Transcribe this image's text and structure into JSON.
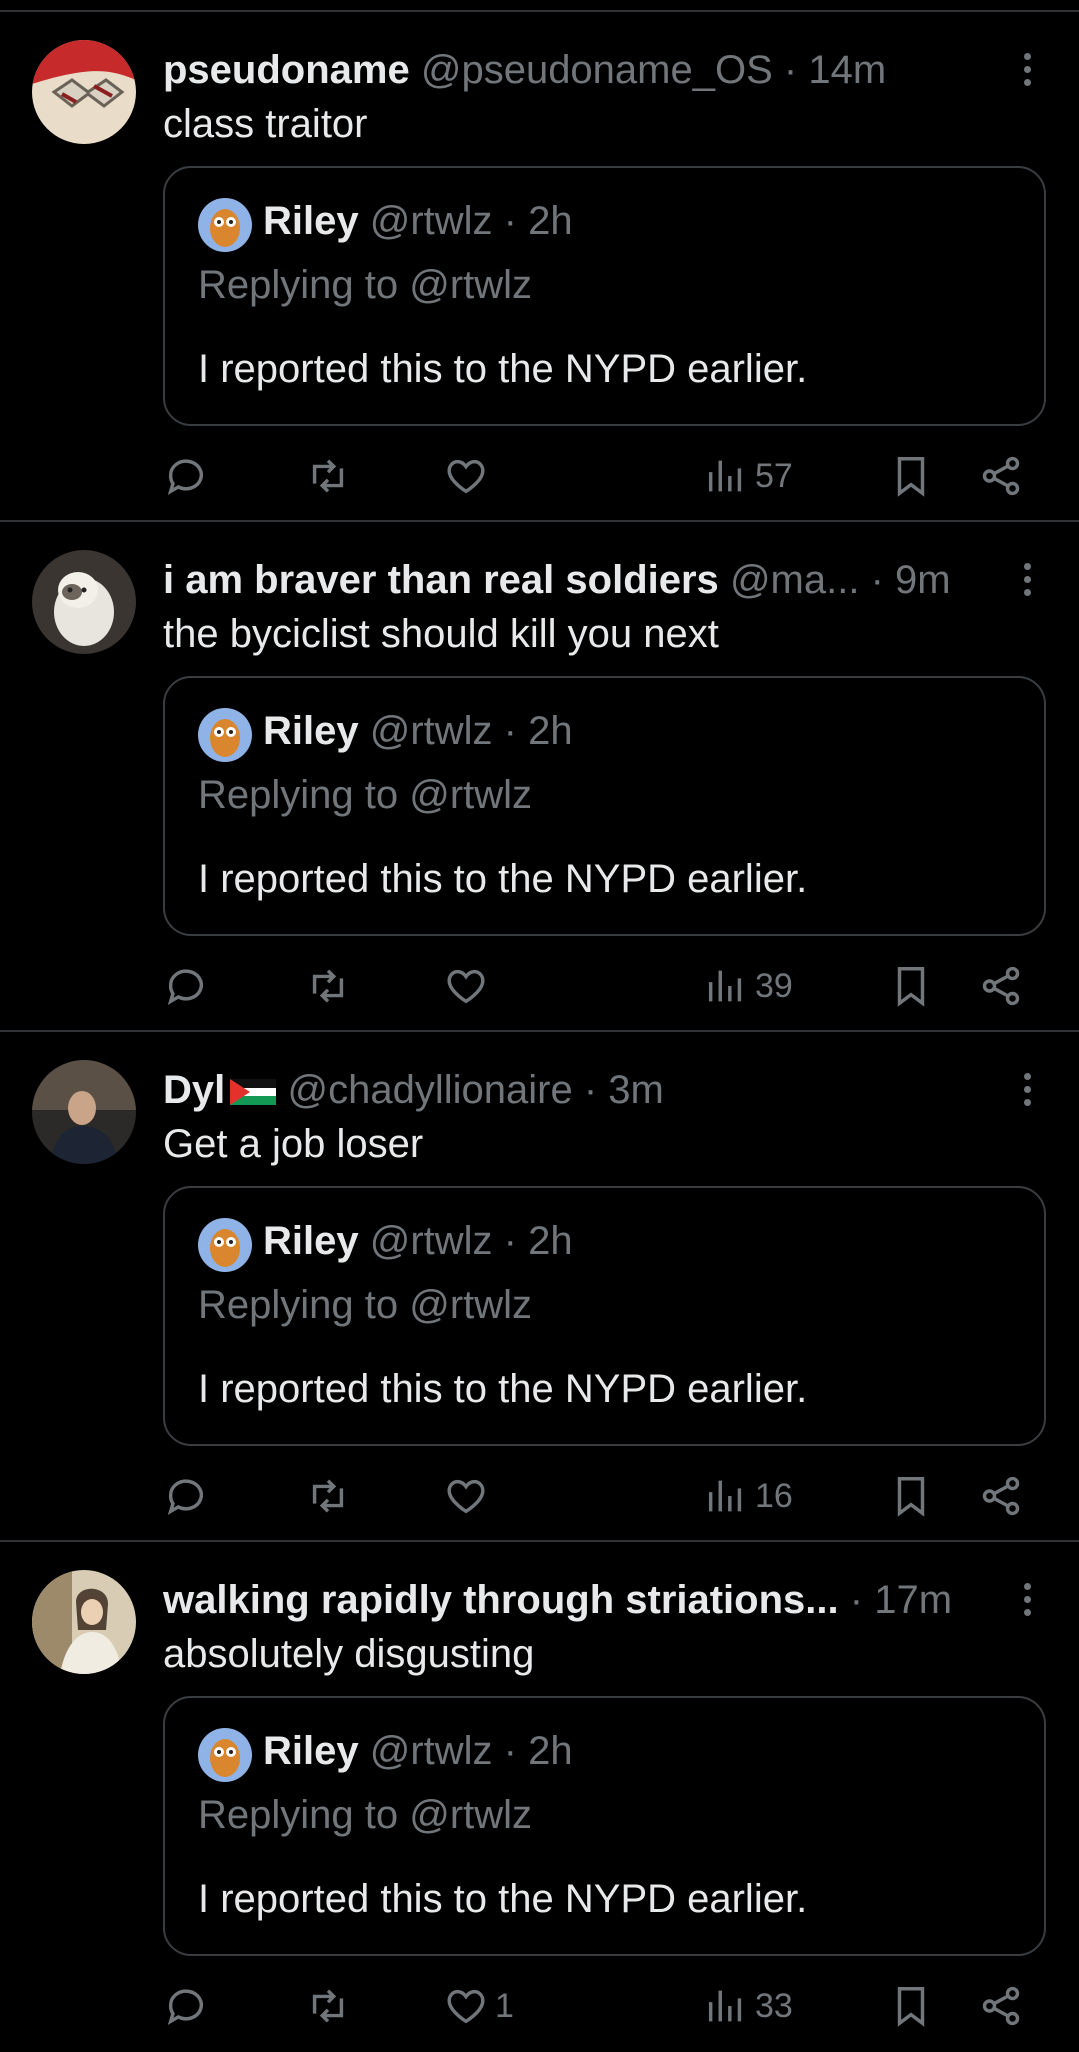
{
  "quoted": {
    "name": "Riley",
    "handle": "@rtwlz",
    "time": "2h",
    "replying": "Replying to @rtwlz",
    "text": "I reported this to the NYPD earlier."
  },
  "tweets": [
    {
      "name": "pseudoname",
      "handle": "@pseudoname_OS",
      "time": "14m",
      "text": "class traitor",
      "likes": "",
      "views": "57"
    },
    {
      "name": "i am braver than real soldiers",
      "handle": "@ma...",
      "time": "9m",
      "text": "the byciclist should kill you next",
      "likes": "",
      "views": "39"
    },
    {
      "name": "Dyl",
      "handle": "@chadyllionaire",
      "time": "3m",
      "text": "Get a job loser",
      "likes": "",
      "views": "16"
    },
    {
      "name": "walking rapidly through striations...",
      "handle": "",
      "time": "17m",
      "text": "absolutely disgusting",
      "likes": "1",
      "views": "33"
    }
  ],
  "separator": "·",
  "icons": [
    "more-icon",
    "reply-icon",
    "retweet-icon",
    "like-icon",
    "views-icon",
    "bookmark-icon",
    "share-icon",
    "palestine-flag-icon"
  ],
  "colors": {
    "background": "#000000",
    "text": "#e7e9ea",
    "muted": "#71767b",
    "border": "#2f3336"
  }
}
